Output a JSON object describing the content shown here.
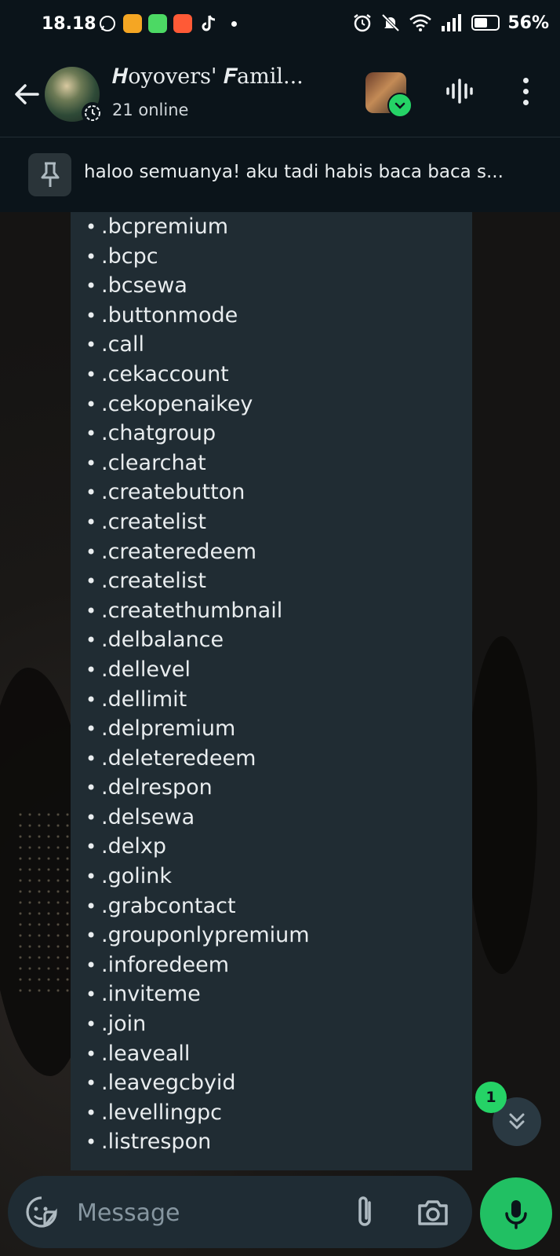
{
  "status_bar": {
    "time": "18.18",
    "battery": "56%",
    "battery_level": 0.56,
    "left_icons": [
      "whatsapp-icon",
      "app-icon-orange",
      "app-icon-green",
      "game-controller-icon",
      "tiktok-icon"
    ],
    "right_icons": [
      "alarm-icon",
      "mute-bell-icon",
      "wifi-icon",
      "signal-icon",
      "battery-icon"
    ]
  },
  "header": {
    "title": "𝑯oyovers' 𝑭amil...",
    "subtitle": "21 online"
  },
  "pinned": {
    "text": "haloo semuanya! aku tadi habis baca baca s..."
  },
  "message": {
    "bullet": "•",
    "commands": [
      ".bcpremium",
      ".bcpc",
      ".bcsewa",
      ".buttonmode",
      ".call",
      ".cekaccount",
      ".cekopenaikey",
      ".chatgroup",
      ".clearchat",
      ".createbutton",
      ".createlist",
      ".createredeem",
      ".createlist",
      ".createthumbnail",
      ".delbalance",
      ".dellevel",
      ".dellimit",
      ".delpremium",
      ".deleteredeem",
      ".delrespon",
      ".delsewa",
      ".delxp",
      ".golink",
      ".grabcontact",
      ".grouponlypremium",
      ".inforedeem",
      ".inviteme",
      ".join",
      ".leaveall",
      ".leavegcbyid",
      ".levellingpc",
      ".listrespon"
    ]
  },
  "scroll": {
    "unread_count": "1"
  },
  "input": {
    "placeholder": "Message"
  },
  "colors": {
    "accent_green": "#21c063",
    "bubble": "#202c33",
    "background": "#0b141a"
  }
}
